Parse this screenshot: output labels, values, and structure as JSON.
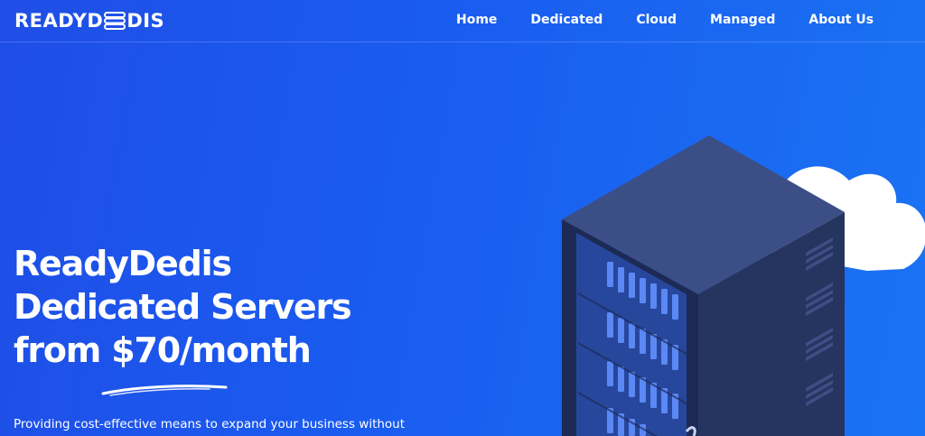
{
  "brand": {
    "name_part1": "READYD",
    "name_part2": "DIS",
    "logo_mark_icon": "server-stack-icon"
  },
  "nav": {
    "items": [
      {
        "label": "Home"
      },
      {
        "label": "Dedicated"
      },
      {
        "label": "Cloud"
      },
      {
        "label": "Managed"
      },
      {
        "label": "About Us"
      }
    ]
  },
  "hero": {
    "title_line1": "ReadyDedis",
    "title_line2": "Dedicated Servers",
    "title_line3_prefix": "from ",
    "title_line3_price": "$70/month",
    "subtitle": "Providing cost-effective means to expand your business without"
  },
  "illustration": {
    "server_icon": "server-rack-icon",
    "cloud_icon": "cloud-icon"
  },
  "colors": {
    "background_start": "#1f4ee6",
    "background_end": "#1a73f2",
    "text": "#ffffff",
    "server_top": "#3b4f86",
    "server_side": "#26355f",
    "server_front": "#1d2a55",
    "drive": "#4d7df0"
  }
}
